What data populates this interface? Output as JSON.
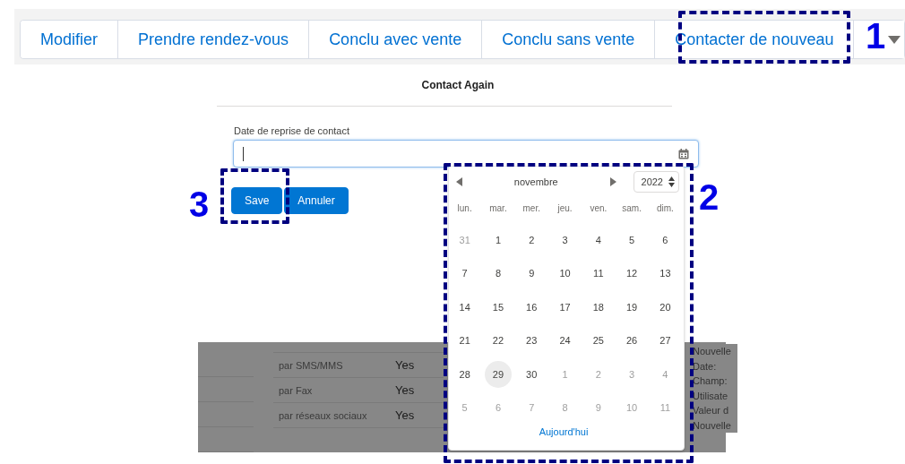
{
  "toolbar": {
    "buttons": [
      {
        "label": "Modifier"
      },
      {
        "label": "Prendre rendez-vous"
      },
      {
        "label": "Conclu avec vente"
      },
      {
        "label": "Conclu sans vente"
      },
      {
        "label": "Contacter de nouveau"
      }
    ]
  },
  "modal": {
    "title": "Contact Again",
    "field_label": "Date de reprise de contact",
    "buttons": [
      "Save",
      "Annuler"
    ]
  },
  "datepicker": {
    "month": "novembre",
    "year": "2022",
    "weekdays": [
      "lun.",
      "mar.",
      "mer.",
      "jeu.",
      "ven.",
      "sam.",
      "dim."
    ],
    "weeks": [
      [
        {
          "day": "31",
          "in_month": false,
          "selected": false
        },
        {
          "day": "1",
          "in_month": true,
          "selected": false
        },
        {
          "day": "2",
          "in_month": true,
          "selected": false
        },
        {
          "day": "3",
          "in_month": true,
          "selected": false
        },
        {
          "day": "4",
          "in_month": true,
          "selected": false
        },
        {
          "day": "5",
          "in_month": true,
          "selected": false
        },
        {
          "day": "6",
          "in_month": true,
          "selected": false
        }
      ],
      [
        {
          "day": "7",
          "in_month": true,
          "selected": false
        },
        {
          "day": "8",
          "in_month": true,
          "selected": false
        },
        {
          "day": "9",
          "in_month": true,
          "selected": false
        },
        {
          "day": "10",
          "in_month": true,
          "selected": false
        },
        {
          "day": "11",
          "in_month": true,
          "selected": false
        },
        {
          "day": "12",
          "in_month": true,
          "selected": false
        },
        {
          "day": "13",
          "in_month": true,
          "selected": false
        }
      ],
      [
        {
          "day": "14",
          "in_month": true,
          "selected": false
        },
        {
          "day": "15",
          "in_month": true,
          "selected": false
        },
        {
          "day": "16",
          "in_month": true,
          "selected": false
        },
        {
          "day": "17",
          "in_month": true,
          "selected": false
        },
        {
          "day": "18",
          "in_month": true,
          "selected": false
        },
        {
          "day": "19",
          "in_month": true,
          "selected": false
        },
        {
          "day": "20",
          "in_month": true,
          "selected": false
        }
      ],
      [
        {
          "day": "21",
          "in_month": true,
          "selected": false
        },
        {
          "day": "22",
          "in_month": true,
          "selected": false
        },
        {
          "day": "23",
          "in_month": true,
          "selected": false
        },
        {
          "day": "24",
          "in_month": true,
          "selected": false
        },
        {
          "day": "25",
          "in_month": true,
          "selected": false
        },
        {
          "day": "26",
          "in_month": true,
          "selected": false
        },
        {
          "day": "27",
          "in_month": true,
          "selected": false
        }
      ],
      [
        {
          "day": "28",
          "in_month": true,
          "selected": false
        },
        {
          "day": "29",
          "in_month": true,
          "selected": true
        },
        {
          "day": "30",
          "in_month": true,
          "selected": false
        },
        {
          "day": "1",
          "in_month": false,
          "selected": false
        },
        {
          "day": "2",
          "in_month": false,
          "selected": false
        },
        {
          "day": "3",
          "in_month": false,
          "selected": false
        },
        {
          "day": "4",
          "in_month": false,
          "selected": false
        }
      ],
      [
        {
          "day": "5",
          "in_month": false,
          "selected": false
        },
        {
          "day": "6",
          "in_month": false,
          "selected": false
        },
        {
          "day": "7",
          "in_month": false,
          "selected": false
        },
        {
          "day": "8",
          "in_month": false,
          "selected": false
        },
        {
          "day": "9",
          "in_month": false,
          "selected": false
        },
        {
          "day": "10",
          "in_month": false,
          "selected": false
        },
        {
          "day": "11",
          "in_month": false,
          "selected": false
        }
      ]
    ],
    "today_link": "Aujourd'hui"
  },
  "background": {
    "rows": [
      {
        "label": "par SMS/MMS",
        "value": "Yes"
      },
      {
        "label": "par Fax",
        "value": "Yes"
      },
      {
        "label": "par réseaux sociaux",
        "value": "Yes"
      }
    ],
    "side_text": [
      "Nouvelle",
      "Date:",
      "Champ:",
      "Utilisate",
      "Valeur d",
      "Nouvelle"
    ]
  },
  "annotations": [
    {
      "number": "1"
    },
    {
      "number": "2"
    },
    {
      "number": "3"
    }
  ]
}
